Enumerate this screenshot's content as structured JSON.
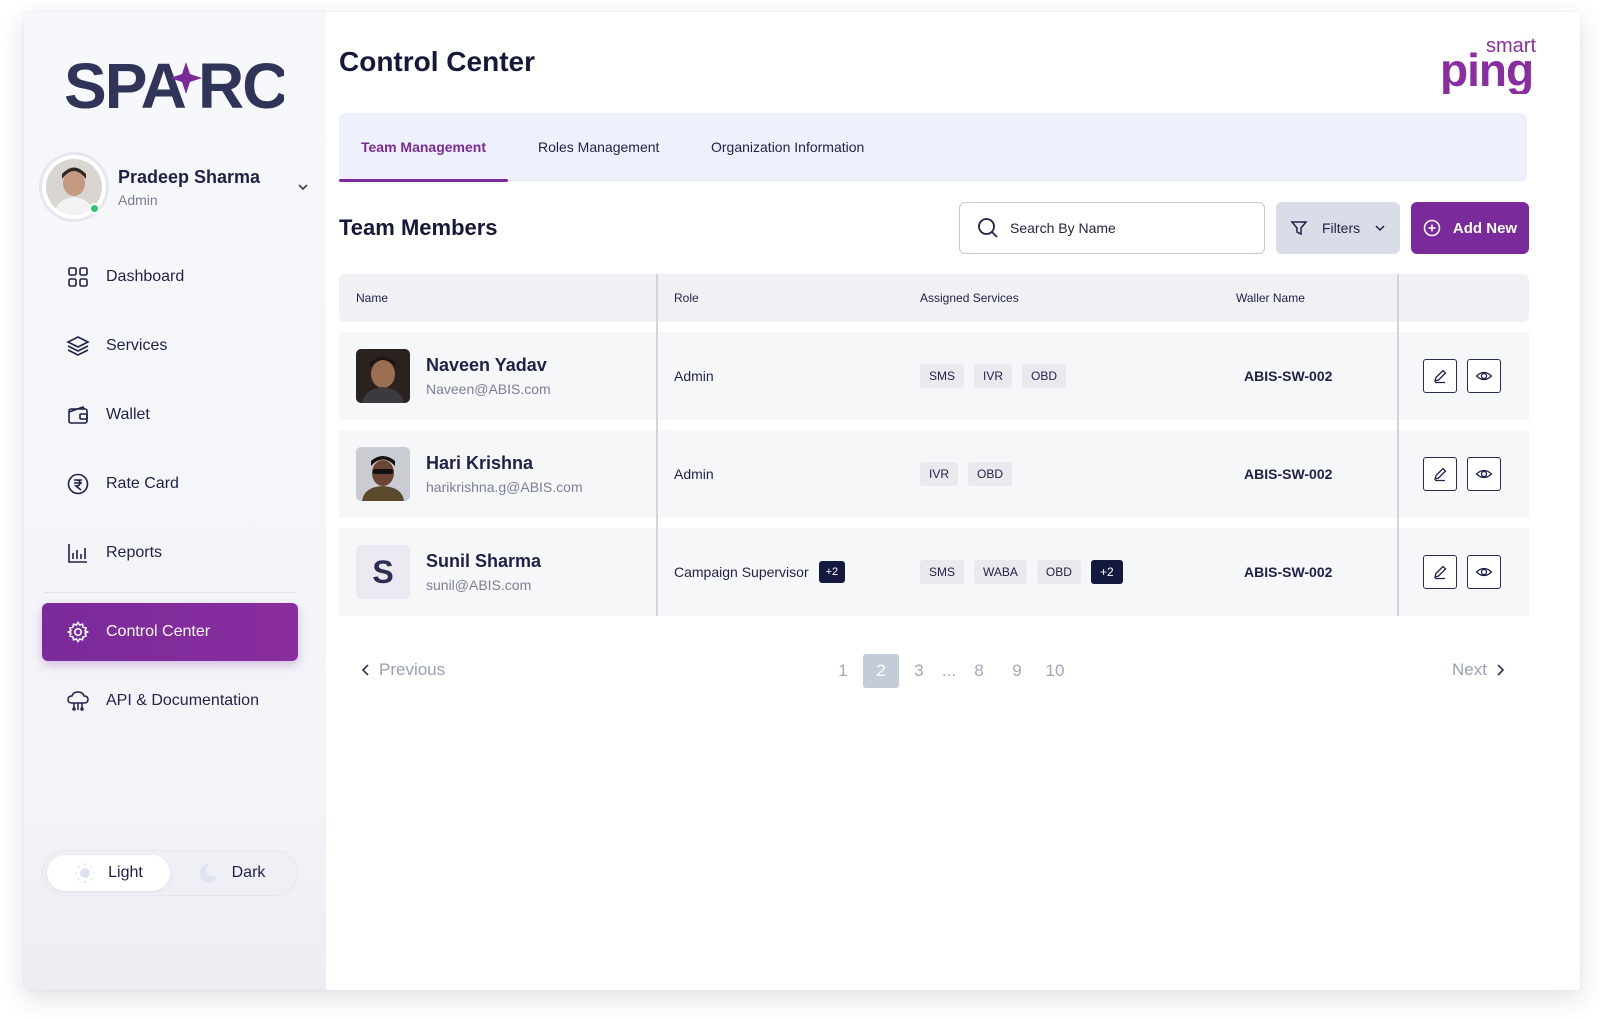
{
  "brand": {
    "logo_text": "SPARC",
    "partner_logo": [
      "smart",
      "ping"
    ]
  },
  "user": {
    "name": "Pradeep Sharma",
    "role": "Admin"
  },
  "sidebar": {
    "items": [
      {
        "label": "Dashboard",
        "icon": "grid-icon"
      },
      {
        "label": "Services",
        "icon": "layers-icon"
      },
      {
        "label": "Wallet",
        "icon": "wallet-icon"
      },
      {
        "label": "Rate Card",
        "icon": "rupee-icon"
      },
      {
        "label": "Reports",
        "icon": "bar-chart-icon"
      },
      {
        "label": "Control Center",
        "icon": "gear-icon",
        "active": true
      },
      {
        "label": "API & Documentation",
        "icon": "cloud-api-icon"
      }
    ],
    "theme": {
      "light": "Light",
      "dark": "Dark",
      "selected": "Light"
    }
  },
  "page": {
    "title": "Control Center"
  },
  "tabs": [
    {
      "label": "Team Management",
      "active": true
    },
    {
      "label": "Roles Management"
    },
    {
      "label": "Organization Information"
    }
  ],
  "team": {
    "title": "Team Members",
    "search_placeholder": "Search By Name",
    "filters_label": "Filters",
    "add_label": "Add New",
    "columns": [
      "Name",
      "Role",
      "Assigned Services",
      "Waller Name"
    ],
    "rows": [
      {
        "name": "Naveen Yadav",
        "email": "Naveen@ABIS.com",
        "role": "Admin",
        "role_extra": "",
        "services": [
          "SMS",
          "IVR",
          "OBD"
        ],
        "services_extra": "",
        "wallet": "ABIS-SW-002"
      },
      {
        "name": "Hari Krishna",
        "email": "harikrishna.g@ABIS.com",
        "role": "Admin",
        "role_extra": "",
        "services": [
          "IVR",
          "OBD"
        ],
        "services_extra": "",
        "wallet": "ABIS-SW-002"
      },
      {
        "name": "Sunil Sharma",
        "email": "sunil@ABIS.com",
        "initial": "S",
        "role": "Campaign Supervisor",
        "role_extra": "+2",
        "services": [
          "SMS",
          "WABA",
          "OBD"
        ],
        "services_extra": "+2",
        "wallet": "ABIS-SW-002"
      }
    ]
  },
  "pagination": {
    "previous": "Previous",
    "next": "Next",
    "pages": [
      "1",
      "2",
      "3",
      "...",
      "8",
      "9",
      "10"
    ],
    "current": "2"
  },
  "colors": {
    "accent": "#7a2a9a",
    "navy": "#15193f",
    "tab_bg": "#eef1fb"
  }
}
